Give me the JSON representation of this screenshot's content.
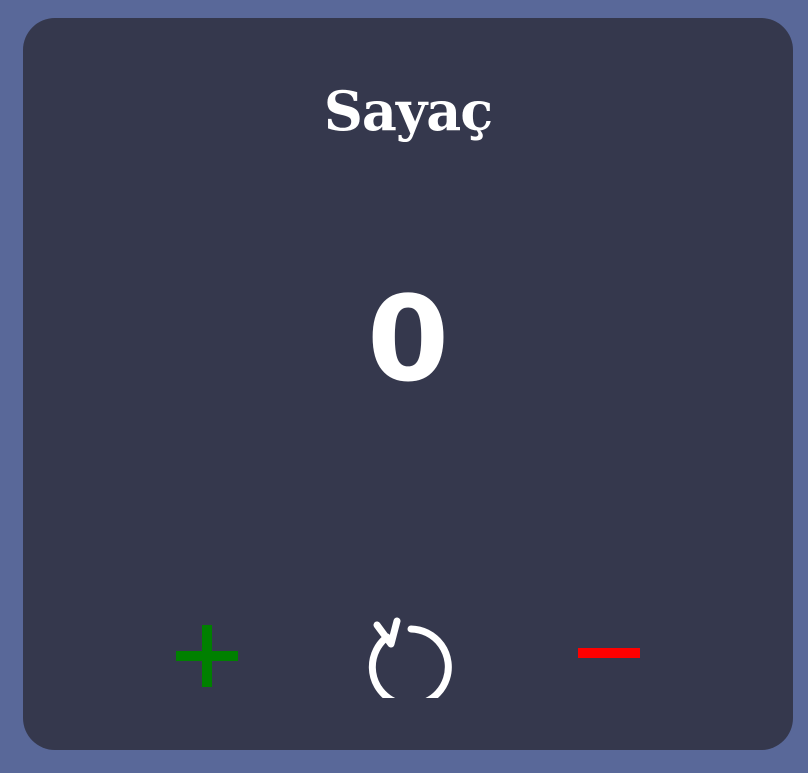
{
  "app": {
    "title": "Sayaç"
  },
  "counter": {
    "value": "0"
  },
  "controls": {
    "increment_icon": "plus-icon",
    "reset_icon": "reset-icon",
    "decrement_icon": "minus-icon"
  },
  "colors": {
    "page_background": "#596899",
    "card_background": "#35384d",
    "text": "#ffffff",
    "increment": "#008000",
    "decrement": "#ff0000",
    "reset": "#ffffff"
  }
}
